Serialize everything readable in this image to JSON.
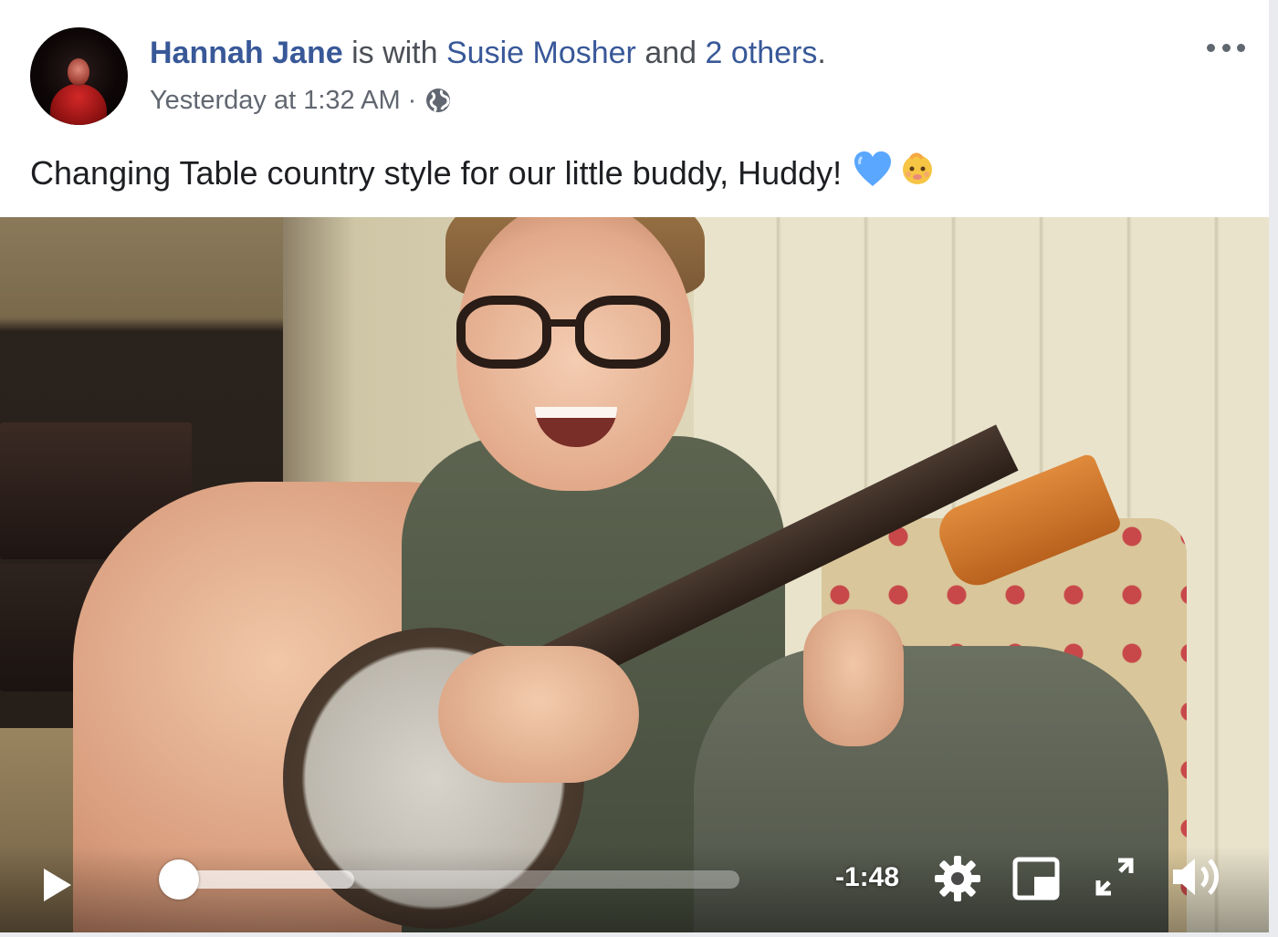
{
  "post": {
    "author_name": "Hannah Jane",
    "is_with": "is with",
    "tagged_person": "Susie Mosher",
    "and_text": "and",
    "others_link": "2 others",
    "period": ".",
    "timestamp": "Yesterday at 1:32 AM",
    "separator": "·",
    "privacy_icon": "globe-icon",
    "more_icon": "more-options-icon",
    "caption": "Changing Table country style for our little buddy, Huddy!",
    "caption_emojis": [
      "blue-heart",
      "baby"
    ]
  },
  "video": {
    "time_remaining": "-1:48",
    "progress_fraction": 0.01,
    "buffered_fraction": 0.32,
    "icons": [
      "play-icon",
      "gear-icon",
      "picture-in-picture-icon",
      "fullscreen-icon",
      "volume-icon"
    ]
  },
  "colors": {
    "link_blue": "#385898",
    "meta_gray": "#616770",
    "heart_blue": "#5aa7ff"
  }
}
